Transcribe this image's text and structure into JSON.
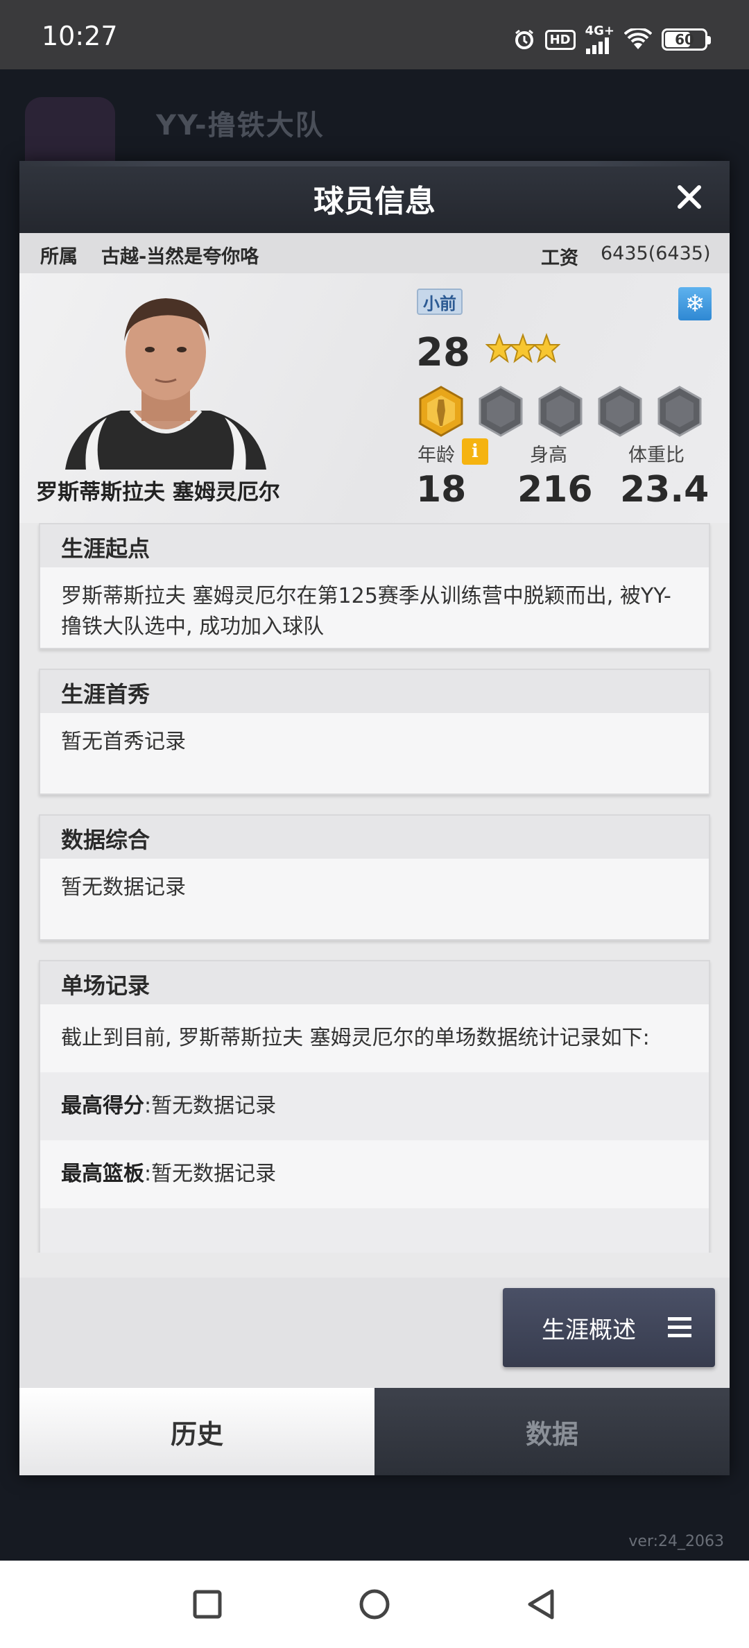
{
  "status_bar": {
    "time": "10:27",
    "network": "4G+",
    "battery": "60",
    "hd": "HD"
  },
  "background": {
    "team_name": "YY-撸铁大队",
    "version": "ver:24_2063"
  },
  "modal": {
    "title": "球员信息",
    "team_label": "所属",
    "team_value": "古越-当然是夸你咯",
    "salary_label": "工资",
    "salary_value": "6435(6435)"
  },
  "player": {
    "name": "罗斯蒂斯拉夫 塞姆灵厄尔",
    "position": "小前",
    "overall": "28",
    "stars": 3,
    "age_label": "年龄",
    "age": "18",
    "height_label": "身高",
    "height": "216",
    "ratio_label": "体重比",
    "ratio": "23.4"
  },
  "sections": {
    "career_start": {
      "title": "生涯起点",
      "text": "罗斯蒂斯拉夫 塞姆灵厄尔在第125赛季从训练营中脱颖而出, 被YY-撸铁大队选中, 成功加入球队"
    },
    "debut": {
      "title": "生涯首秀",
      "text": "暂无首秀记录"
    },
    "summary": {
      "title": "数据综合",
      "text": "暂无数据记录"
    },
    "single": {
      "title": "单场记录",
      "intro": "截止到目前, 罗斯蒂斯拉夫 塞姆灵厄尔的单场数据统计记录如下:",
      "rows": [
        {
          "label": "最高得分",
          "value": ":暂无数据记录"
        },
        {
          "label": "最高篮板",
          "value": ":暂无数据记录"
        }
      ]
    }
  },
  "footer": {
    "career_button": "生涯概述",
    "tab_history": "历史",
    "tab_data": "数据"
  },
  "colors": {
    "header": "#2b2e36",
    "accent_gold": "#f5b310",
    "active_tab": "#ffffff",
    "inactive_tab": "#33363f"
  }
}
